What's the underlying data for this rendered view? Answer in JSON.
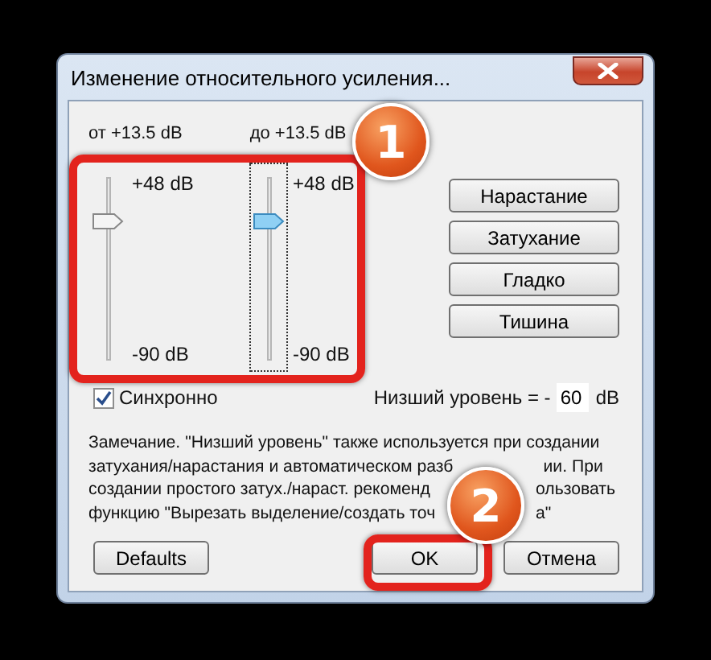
{
  "window": {
    "title": "Изменение относительного усиления..."
  },
  "range_labels": [
    "от +13.5 dB",
    "до +13.5 dB"
  ],
  "sliders": [
    {
      "top": "+48 dB",
      "bottom": "-90 dB",
      "level": 0.75,
      "focused": false
    },
    {
      "top": "+48 dB",
      "bottom": "-90 dB",
      "level": 0.75,
      "focused": true
    }
  ],
  "side_buttons": [
    "Нарастание",
    "Затухание",
    "Гладко",
    "Тишина"
  ],
  "sync_checkbox": {
    "label": "Синхронно",
    "checked": true
  },
  "floor": {
    "label": "Низший уровень =  -",
    "value": "60",
    "unit": "dB"
  },
  "note": {
    "first_line": "Замечание. \"Низший уровень\" также используется при создании",
    "lines": [
      [
        "затухания/нарастания и автоматическом разб",
        "ии. При"
      ],
      [
        "создании простого затух./нараст. рекоменд",
        "ользовать"
      ],
      [
        "функцию \"Вырезать выделение/создать точ",
        "а\""
      ]
    ]
  },
  "buttons": [
    {
      "label": "Defaults",
      "kind": "left"
    },
    {
      "label": "OK",
      "kind": "right"
    },
    {
      "label": "Отмена",
      "kind": "right"
    }
  ],
  "annotations": [
    {
      "number": "1"
    },
    {
      "number": "2"
    }
  ]
}
